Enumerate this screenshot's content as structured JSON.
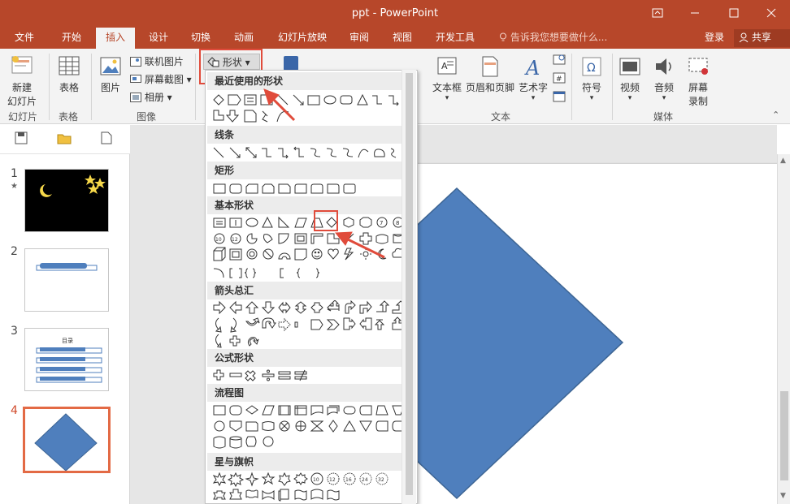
{
  "window": {
    "title": "ppt - PowerPoint"
  },
  "tabs": [
    {
      "label": "文件"
    },
    {
      "label": "开始"
    },
    {
      "label": "插入"
    },
    {
      "label": "设计"
    },
    {
      "label": "切换"
    },
    {
      "label": "动画"
    },
    {
      "label": "幻灯片放映"
    },
    {
      "label": "审阅"
    },
    {
      "label": "视图"
    },
    {
      "label": "开发工具"
    }
  ],
  "tell_me": "告诉我您想要做什么...",
  "login": "登录",
  "share": "共享",
  "ribbon": {
    "new_slide_1": "新建",
    "new_slide_2": "幻灯片",
    "table": "表格",
    "picture": "图片",
    "online_picture": "联机图片",
    "screenshot": "屏幕截图",
    "album": "相册",
    "shapes": "形状",
    "textbox": "文本框",
    "header_footer": "页眉和页脚",
    "wordart": "艺术字",
    "symbol": "符号",
    "video": "视频",
    "audio": "音频",
    "screen_rec_1": "屏幕",
    "screen_rec_2": "录制",
    "groups": {
      "slides": "幻灯片",
      "tables": "表格",
      "images": "图像",
      "text": "文本",
      "media": "媒体"
    }
  },
  "shapes_menu": {
    "categories": [
      "最近使用的形状",
      "线条",
      "矩形",
      "基本形状",
      "箭头总汇",
      "公式形状",
      "流程图",
      "星与旗帜"
    ]
  },
  "slides": [
    {
      "number": "1",
      "star": "★"
    },
    {
      "number": "2"
    },
    {
      "number": "3",
      "toc_title": "目录"
    },
    {
      "number": "4"
    }
  ],
  "colors": {
    "accent": "#b7472a",
    "shape_fill": "#4f7fbd",
    "shape_stroke": "#3d6594",
    "annotation": "#e04b3b"
  }
}
